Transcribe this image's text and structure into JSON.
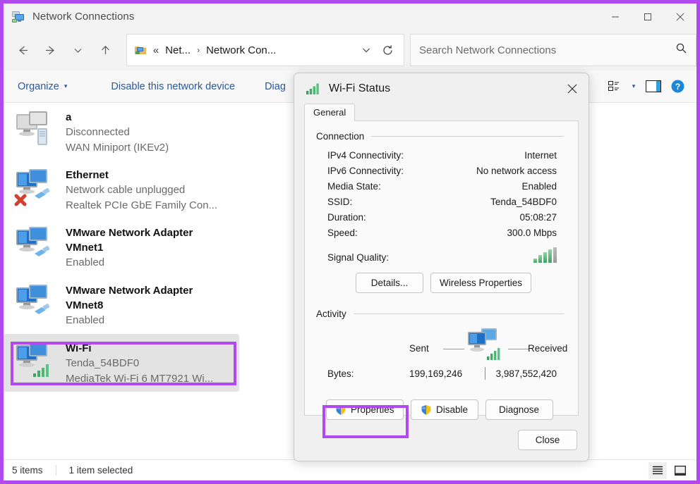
{
  "window": {
    "title": "Network Connections",
    "icon": "network-connections-icon",
    "controls": {
      "minimize": "minimize-icon",
      "maximize": "maximize-icon",
      "close": "close-icon"
    }
  },
  "nav": {
    "back": "back-arrow-icon",
    "forward": "forward-arrow-icon",
    "recent": "chevron-down-icon",
    "up": "up-arrow-icon",
    "address": {
      "icon": "folder-network-icon",
      "overflow": "«",
      "crumb1": "Net...",
      "separator": "›",
      "crumb2": "Network Con...",
      "dropdown": "chevron-down-icon",
      "refresh": "refresh-icon"
    },
    "search": {
      "placeholder": "Search Network Connections",
      "icon": "search-icon"
    }
  },
  "commandbar": {
    "organize": "Organize",
    "organize_caret": "▾",
    "disable_device": "Disable this network device",
    "diagnose": "Diag",
    "view_icon": "view-options-icon",
    "view_caret": "▾",
    "preview_pane_icon": "preview-pane-icon",
    "help_icon": "help-icon"
  },
  "connections": [
    {
      "name": "a",
      "status": "Disconnected",
      "device": "WAN Miniport (IKEv2)",
      "icon": "network-adapter-disabled-icon",
      "selected": false
    },
    {
      "name": "Ethernet",
      "status": "Network cable unplugged",
      "device": "Realtek PCIe GbE Family Con...",
      "icon": "ethernet-unplugged-icon",
      "selected": false
    },
    {
      "name": "VMware Network Adapter",
      "status": "VMnet1",
      "device": "Enabled",
      "icon": "ethernet-adapter-icon",
      "selected": false
    },
    {
      "name": "VMware Network Adapter",
      "status": "VMnet8",
      "device": "Enabled",
      "icon": "ethernet-adapter-icon",
      "selected": false
    },
    {
      "name": "Wi-Fi",
      "status": "Tenda_54BDF0",
      "device": "MediaTek Wi-Fi 6 MT7921 Wi...",
      "icon": "wifi-adapter-icon",
      "selected": true
    }
  ],
  "statusbar": {
    "items": "5 items",
    "selected": "1 item selected",
    "details_view_icon": "details-view-icon",
    "large_icons_view_icon": "large-icons-view-icon"
  },
  "dialog": {
    "title": "Wi-Fi Status",
    "icon": "wifi-signal-icon",
    "close_icon": "close-icon",
    "tabs": [
      {
        "label": "General",
        "active": true
      }
    ],
    "connection": {
      "group_label": "Connection",
      "rows": [
        {
          "key": "IPv4 Connectivity:",
          "value": "Internet"
        },
        {
          "key": "IPv6 Connectivity:",
          "value": "No network access"
        },
        {
          "key": "Media State:",
          "value": "Enabled"
        },
        {
          "key": "SSID:",
          "value": "Tenda_54BDF0"
        },
        {
          "key": "Duration:",
          "value": "05:08:27"
        },
        {
          "key": "Speed:",
          "value": "300.0 Mbps"
        }
      ],
      "signal_label": "Signal Quality:",
      "signal_bars_filled": 4,
      "signal_bars_total": 5,
      "details_button": "Details...",
      "wireless_properties_button": "Wireless Properties"
    },
    "activity": {
      "group_label": "Activity",
      "sent_label": "Sent",
      "received_label": "Received",
      "monitor_icon": "network-activity-icon",
      "bytes_label": "Bytes:",
      "bytes_sent": "199,169,246",
      "bytes_received": "3,987,552,420"
    },
    "actions": {
      "properties": "Properties",
      "properties_icon": "uac-shield-icon",
      "disable": "Disable",
      "disable_icon": "uac-shield-icon",
      "diagnose": "Diagnose",
      "close": "Close"
    }
  },
  "annotations": {
    "highlight_color": "#b14aee",
    "targets": [
      "wifi-list-item",
      "properties-button"
    ]
  }
}
